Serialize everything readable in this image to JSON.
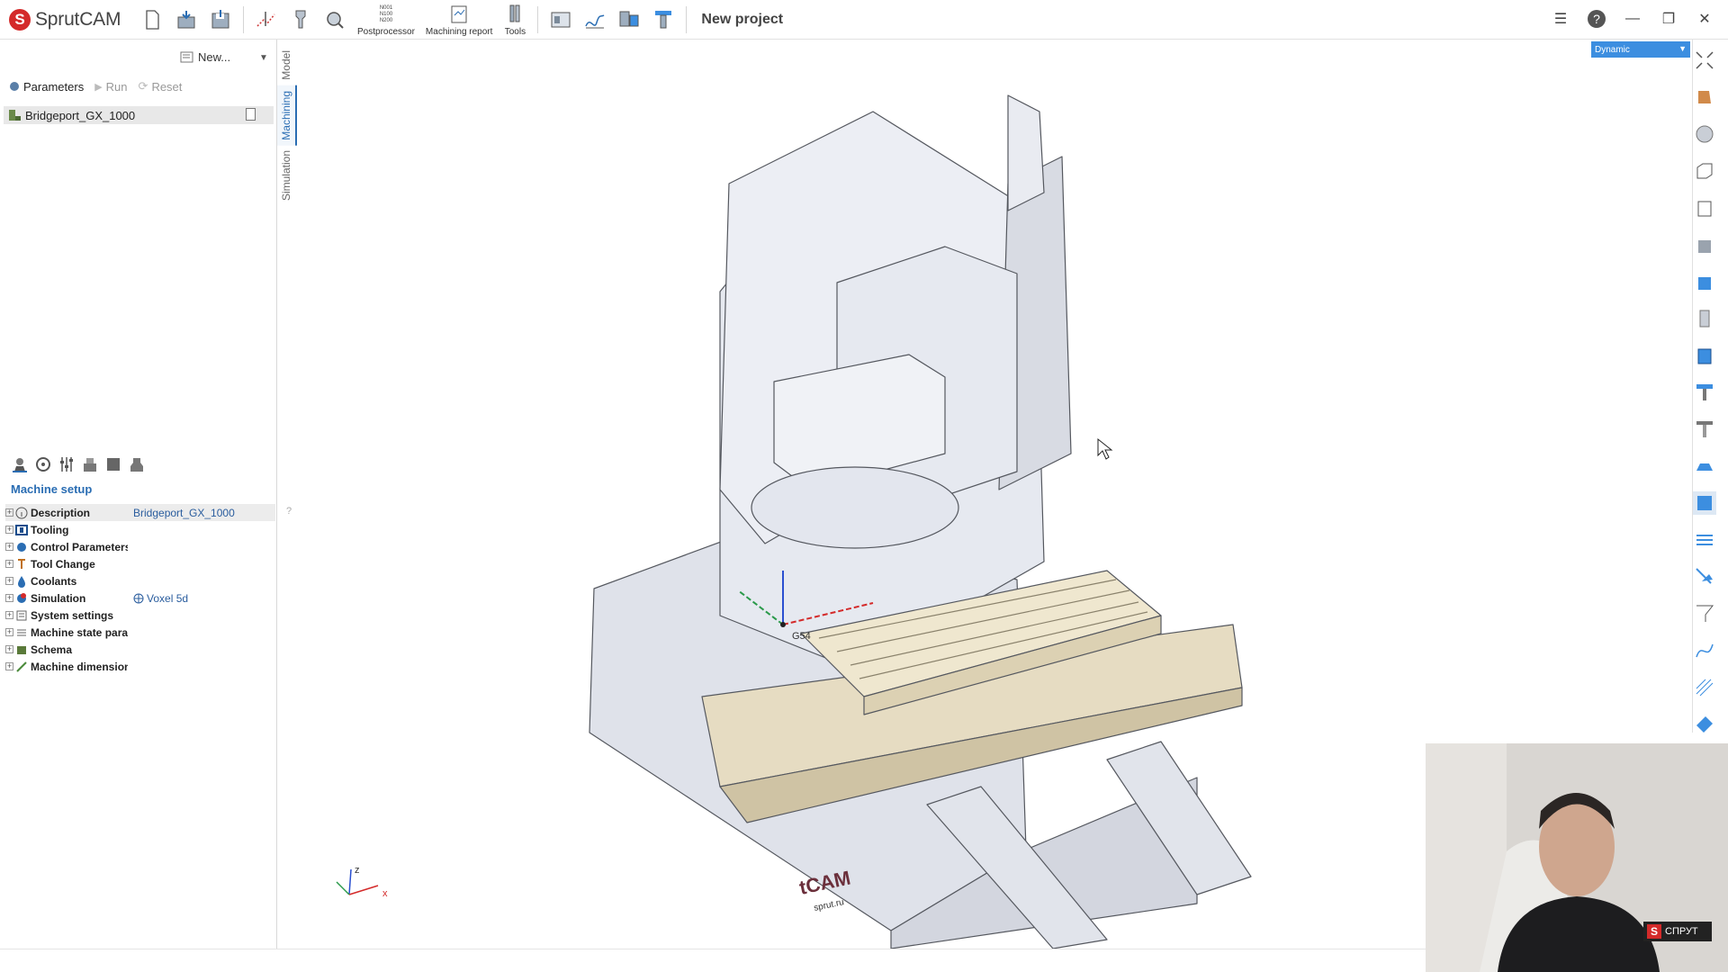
{
  "app": {
    "name": "SprutCAM",
    "project_title": "New project"
  },
  "toolbar": {
    "postprocessor_label": "Postprocessor",
    "postprocessor_glyph": [
      "N001",
      "N100",
      "N200"
    ],
    "machining_report_label": "Machining report",
    "tools_label": "Tools"
  },
  "left_panel": {
    "new_button_label": "New...",
    "actions": {
      "parameters": "Parameters",
      "run": "Run",
      "reset": "Reset"
    },
    "machine_item": "Bridgeport_GX_1000",
    "vertical_tabs": [
      "Model",
      "Machining",
      "Simulation"
    ],
    "active_tab": "Machining",
    "setup_title": "Machine setup",
    "properties": [
      {
        "name": "Description",
        "value": "Bridgeport_GX_1000"
      },
      {
        "name": "Tooling",
        "value": ""
      },
      {
        "name": "Control Parameters",
        "value": ""
      },
      {
        "name": "Tool Change",
        "value": ""
      },
      {
        "name": "Coolants",
        "value": ""
      },
      {
        "name": "Simulation",
        "value": "Voxel 5d"
      },
      {
        "name": "System settings",
        "value": ""
      },
      {
        "name": "Machine state parameters",
        "value": ""
      },
      {
        "name": "Schema",
        "value": ""
      },
      {
        "name": "Machine dimensions",
        "value": ""
      }
    ],
    "help_mark": "?"
  },
  "viewport": {
    "view_mode": "Dynamic",
    "coordinate_system_label": "G54",
    "axis_labels": {
      "x": "x",
      "z": "z"
    },
    "machine_logo": "tCAM",
    "machine_logo_sub": "sprut.ru"
  },
  "webcam": {
    "badge_text": "СПРУТ"
  },
  "colors": {
    "accent": "#2a6db3",
    "brand_red": "#d42a2a",
    "machine_body": "#e3e6ee",
    "table": "#e6dcc2"
  }
}
